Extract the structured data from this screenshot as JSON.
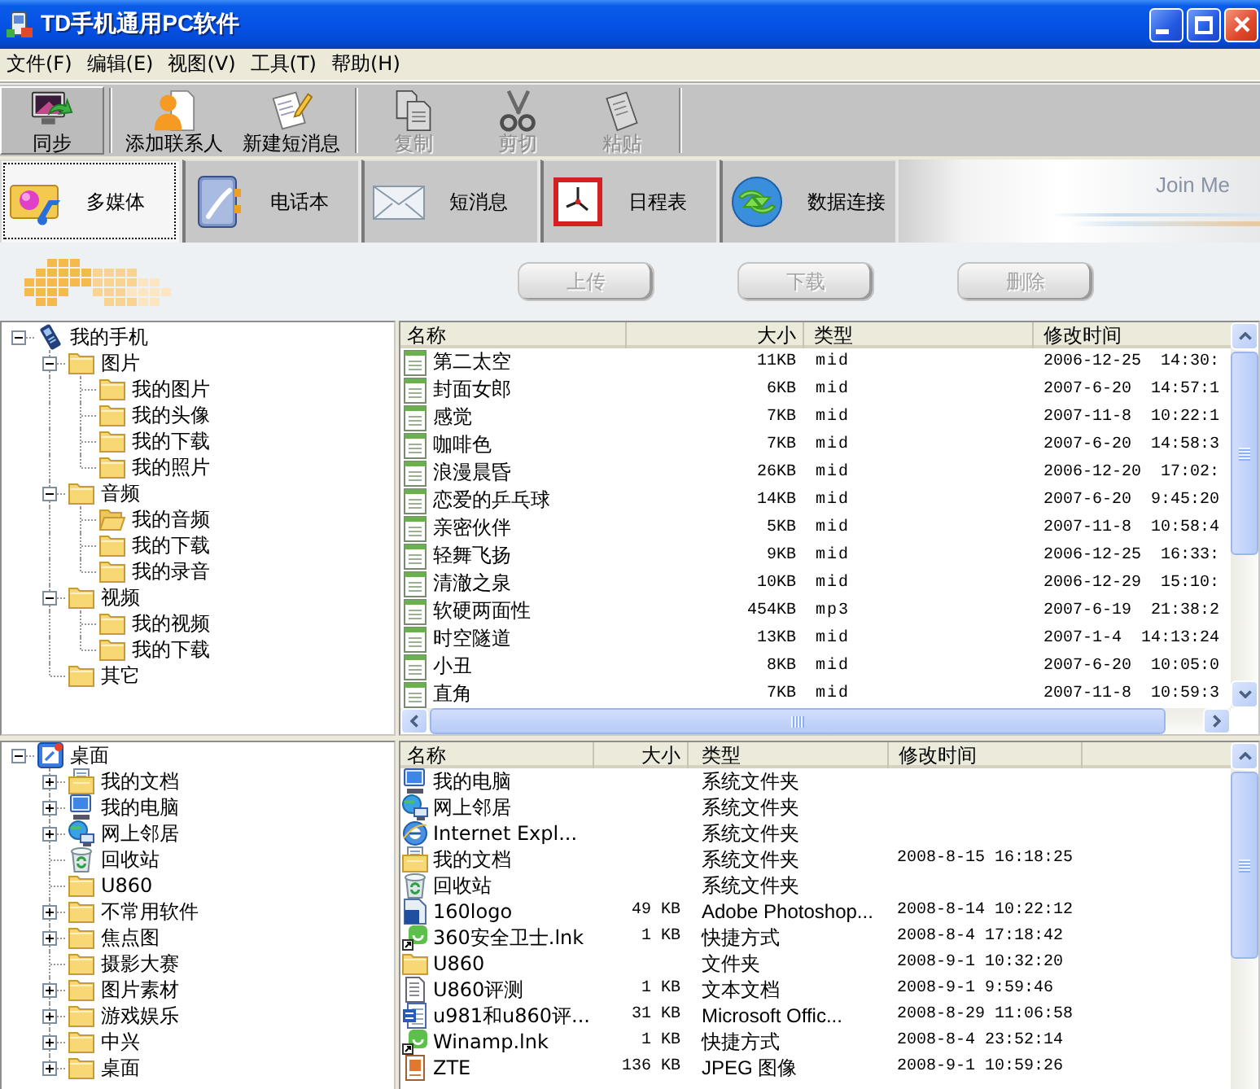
{
  "window": {
    "title": "TD手机通用PC软件"
  },
  "menu": [
    "文件(F)",
    "编辑(E)",
    "视图(V)",
    "工具(T)",
    "帮助(H)"
  ],
  "toolbar": {
    "groups": [
      {
        "buttons": [
          {
            "label": "同步",
            "disabled": false,
            "pressed": true
          }
        ]
      },
      {
        "buttons": [
          {
            "label": "添加联系人",
            "disabled": false,
            "pressed": false
          },
          {
            "label": "新建短消息",
            "disabled": false,
            "pressed": false
          }
        ]
      },
      {
        "buttons": [
          {
            "label": "复制",
            "disabled": true,
            "pressed": false
          },
          {
            "label": "剪切",
            "disabled": true,
            "pressed": false
          },
          {
            "label": "粘贴",
            "disabled": true,
            "pressed": false
          }
        ]
      }
    ]
  },
  "tabs": [
    {
      "label": "多媒体",
      "selected": true
    },
    {
      "label": "电话本",
      "selected": false
    },
    {
      "label": "短消息",
      "selected": false
    },
    {
      "label": "日程表",
      "selected": false
    },
    {
      "label": "数据连接",
      "selected": false
    }
  ],
  "banner": {
    "text": "Join Me"
  },
  "actions": [
    {
      "label": "上传",
      "disabled": true
    },
    {
      "label": "下载",
      "disabled": true
    },
    {
      "label": "删除",
      "disabled": true
    }
  ],
  "phone_tree": {
    "items": [
      {
        "label": "我的手机",
        "kind": "phone",
        "expanded": true,
        "selected": false,
        "children": [
          {
            "label": "图片",
            "kind": "folder",
            "expanded": true,
            "selected": false,
            "children": [
              {
                "label": "我的图片",
                "kind": "folder",
                "selected": false
              },
              {
                "label": "我的头像",
                "kind": "folder",
                "selected": false
              },
              {
                "label": "我的下载",
                "kind": "folder",
                "selected": false
              },
              {
                "label": "我的照片",
                "kind": "folder",
                "selected": false
              }
            ]
          },
          {
            "label": "音频",
            "kind": "folder",
            "expanded": true,
            "selected": false,
            "children": [
              {
                "label": "我的音频",
                "kind": "folder",
                "selected": true
              },
              {
                "label": "我的下载",
                "kind": "folder",
                "selected": false
              },
              {
                "label": "我的录音",
                "kind": "folder",
                "selected": false
              }
            ]
          },
          {
            "label": "视频",
            "kind": "folder",
            "expanded": true,
            "selected": false,
            "children": [
              {
                "label": "我的视频",
                "kind": "folder",
                "selected": false
              },
              {
                "label": "我的下载",
                "kind": "folder",
                "selected": false
              }
            ]
          },
          {
            "label": "其它",
            "kind": "folder",
            "selected": false
          }
        ]
      }
    ]
  },
  "phone_files": {
    "columns": [
      "名称",
      "大小",
      "类型",
      "修改时间"
    ],
    "rows": [
      {
        "name": "第二太空",
        "size": "11KB",
        "type": "mid",
        "modified": "2006-12-25  14:30:"
      },
      {
        "name": "封面女郎",
        "size": "6KB",
        "type": "mid",
        "modified": "2007-6-20  14:57:1"
      },
      {
        "name": "感觉",
        "size": "7KB",
        "type": "mid",
        "modified": "2007-11-8  10:22:1"
      },
      {
        "name": "咖啡色",
        "size": "7KB",
        "type": "mid",
        "modified": "2007-6-20  14:58:3"
      },
      {
        "name": "浪漫晨昏",
        "size": "26KB",
        "type": "mid",
        "modified": "2006-12-20  17:02:"
      },
      {
        "name": "恋爱的乒乓球",
        "size": "14KB",
        "type": "mid",
        "modified": "2007-6-20  9:45:20"
      },
      {
        "name": "亲密伙伴",
        "size": "5KB",
        "type": "mid",
        "modified": "2007-11-8  10:58:4"
      },
      {
        "name": "轻舞飞扬",
        "size": "9KB",
        "type": "mid",
        "modified": "2006-12-25  16:33:"
      },
      {
        "name": "清澈之泉",
        "size": "10KB",
        "type": "mid",
        "modified": "2006-12-29  15:10:"
      },
      {
        "name": "软硬两面性",
        "size": "454KB",
        "type": "mp3",
        "modified": "2007-6-19  21:38:2"
      },
      {
        "name": "时空隧道",
        "size": "13KB",
        "type": "mid",
        "modified": "2007-1-4  14:13:24"
      },
      {
        "name": "小丑",
        "size": "8KB",
        "type": "mid",
        "modified": "2007-6-20  10:05:0"
      },
      {
        "name": "直角",
        "size": "7KB",
        "type": "mid",
        "modified": "2007-11-8  10:59:3"
      }
    ]
  },
  "pc_tree": {
    "items": [
      {
        "label": "桌面",
        "kind": "desktop",
        "expanded": true,
        "selected": false,
        "children": [
          {
            "label": "我的文档",
            "kind": "documents",
            "expanded": false,
            "selected": false
          },
          {
            "label": "我的电脑",
            "kind": "computer",
            "expanded": false,
            "selected": false
          },
          {
            "label": "网上邻居",
            "kind": "network",
            "expanded": false,
            "selected": false
          },
          {
            "label": "回收站",
            "kind": "recycle-bin",
            "selected": false
          },
          {
            "label": "U860",
            "kind": "folder",
            "selected": false
          },
          {
            "label": "不常用软件",
            "kind": "folder",
            "expanded": false,
            "selected": false
          },
          {
            "label": "焦点图",
            "kind": "folder",
            "expanded": false,
            "selected": false
          },
          {
            "label": "摄影大赛",
            "kind": "folder",
            "selected": false
          },
          {
            "label": "图片素材",
            "kind": "folder",
            "expanded": false,
            "selected": false
          },
          {
            "label": "游戏娱乐",
            "kind": "folder",
            "expanded": false,
            "selected": false
          },
          {
            "label": "中兴",
            "kind": "folder",
            "expanded": false,
            "selected": false
          },
          {
            "label": "桌面",
            "kind": "folder",
            "expanded": false,
            "selected": false
          }
        ]
      }
    ]
  },
  "pc_files": {
    "columns": [
      "名称",
      "大小",
      "类型",
      "修改时间"
    ],
    "rows": [
      {
        "kind": "computer",
        "name": "我的电脑",
        "type": "系统文件夹"
      },
      {
        "kind": "network",
        "name": "网上邻居",
        "type": "系统文件夹"
      },
      {
        "kind": "browser",
        "name": "Internet Expl...",
        "type": "系统文件夹"
      },
      {
        "kind": "documents",
        "name": "我的文档",
        "type": "系统文件夹",
        "modified": "2008-8-15 16:18:25"
      },
      {
        "kind": "recycle-bin",
        "name": "回收站",
        "type": "系统文件夹"
      },
      {
        "kind": "design-file",
        "name": "160logo",
        "size": "49 KB",
        "type": "Adobe Photoshop...",
        "modified": "2008-8-14 10:22:12"
      },
      {
        "kind": "shortcut",
        "name": "360安全卫士.lnk",
        "size": "1 KB",
        "type": "快捷方式",
        "modified": "2008-8-4 17:18:42"
      },
      {
        "kind": "folder",
        "name": "U860",
        "type": "文件夹",
        "modified": "2008-9-1 10:32:20"
      },
      {
        "kind": "text-file",
        "name": "U860评测",
        "size": "1 KB",
        "type": "文本文档",
        "modified": "2008-9-1 9:59:46"
      },
      {
        "kind": "word-file",
        "name": "u981和u860评...",
        "size": "31 KB",
        "type": "Microsoft Offic...",
        "modified": "2008-8-29 11:06:58"
      },
      {
        "kind": "shortcut",
        "name": "Winamp.lnk",
        "size": "1 KB",
        "type": "快捷方式",
        "modified": "2008-8-4 23:52:14"
      },
      {
        "kind": "image-file",
        "name": "ZTE",
        "size": "136 KB",
        "type": "JPEG 图像",
        "modified": "2008-9-1 10:59:26"
      }
    ]
  }
}
